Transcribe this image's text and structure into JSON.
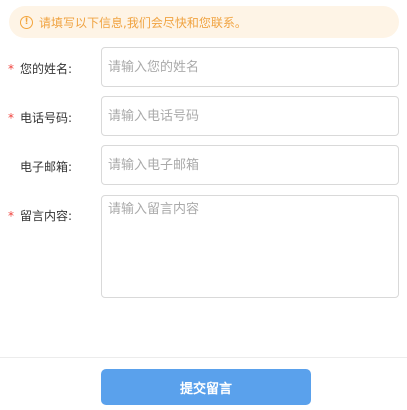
{
  "notice": {
    "icon": "exclamation-circle-icon",
    "text": "请填写以下信息,我们会尽快和您联系。"
  },
  "form": {
    "required_mark": "*",
    "fields": [
      {
        "label": "您的姓名:",
        "required": true,
        "placeholder": "请输入您的姓名",
        "value": ""
      },
      {
        "label": "电话号码:",
        "required": true,
        "placeholder": "请输入电话号码",
        "value": ""
      },
      {
        "label": "电子邮箱:",
        "required": false,
        "placeholder": "请输入电子邮箱",
        "value": ""
      },
      {
        "label": "留言内容:",
        "required": true,
        "placeholder": "请输入留言内容",
        "value": ""
      }
    ]
  },
  "submit": {
    "label": "提交留言"
  },
  "colors": {
    "accent": "#5aa1ec",
    "notice_bg": "#fef4e6",
    "notice_text": "#f0a341",
    "required": "#f0433d"
  }
}
